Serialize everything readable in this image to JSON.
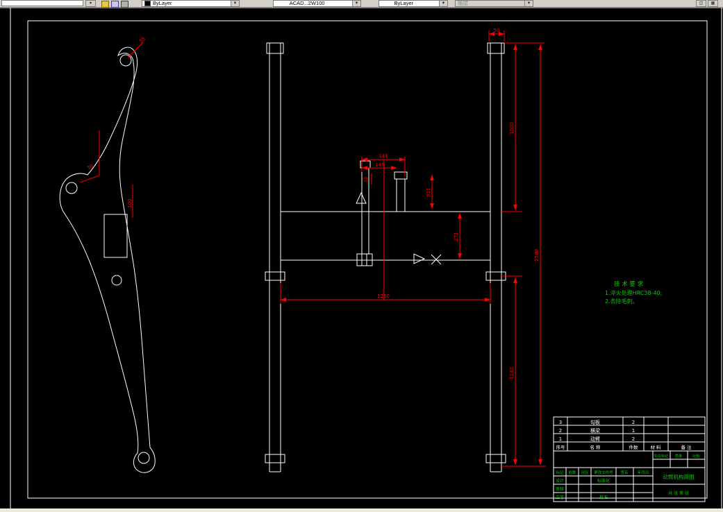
{
  "toolbar": {
    "color_value": "ByLayer",
    "linetype_value": "ACAD...2W100",
    "lineweight_value": "ByLayer",
    "plotstyle_value": "随层"
  },
  "drawing": {
    "dims": {
      "cap_width": "50",
      "rail_upper": "1000",
      "total_height": "2500",
      "rail_lower": "1140",
      "beam_span": "1260",
      "beam_height": "271",
      "bracket_outer": "148",
      "bracket_inner": "145",
      "stub_height": "311",
      "plate_thickness": "13",
      "arm_top": "55",
      "arm_angle": "30",
      "arm_offset": "100"
    },
    "notes": {
      "heading": "技 术 要 求",
      "line1": "1.淬火处理HRC38-40;",
      "line2": "2.去除毛刺。"
    },
    "title_block": {
      "parts": [
        {
          "no": "3",
          "name": "勾板",
          "qty": "2"
        },
        {
          "no": "2",
          "name": "横梁",
          "qty": "1"
        },
        {
          "no": "1",
          "name": "动臂",
          "qty": "2"
        }
      ],
      "headers": {
        "no": "序号",
        "name": "名  称",
        "qty": "件数",
        "material": "材 料",
        "remark": "备 注"
      },
      "rev_row": [
        "标记",
        "处数",
        "分区",
        "更改文件号",
        "签名",
        "年月日"
      ],
      "roles": {
        "design": "设计",
        "standard": "标准化",
        "check": "审核",
        "process": "工艺",
        "approve": "批准"
      },
      "stage": {
        "mark": "阶段标记",
        "weight": "质量",
        "scale": "比例"
      },
      "sheet": "共 张 第 张",
      "title": "动臂机构简图"
    }
  },
  "colors": {
    "geometry": "#ffffff",
    "dimension": "#ff0000",
    "annotation": "#00cc00",
    "toolbar_bg": "#d4d0c8"
  }
}
